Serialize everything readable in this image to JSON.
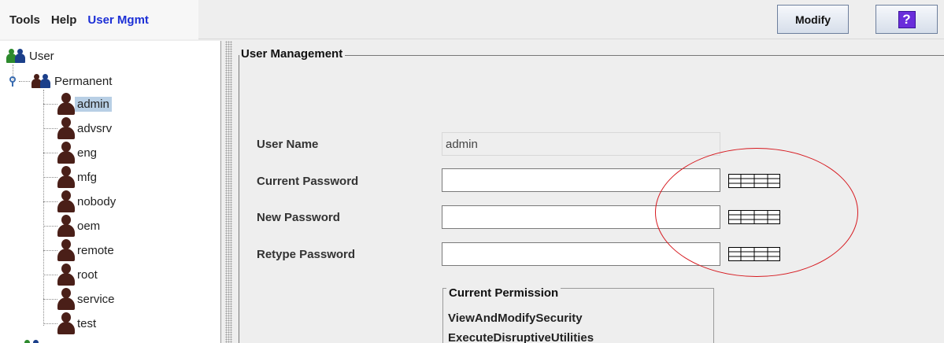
{
  "menu": {
    "tools": "Tools",
    "help": "Help",
    "user_mgmt": "User Mgmt"
  },
  "toolbar": {
    "modify_label": "Modify",
    "help_label": "?"
  },
  "tree": {
    "root": "User",
    "permanent": "Permanent",
    "users": [
      "admin",
      "advsrv",
      "eng",
      "mfg",
      "nobody",
      "oem",
      "remote",
      "root",
      "service",
      "test"
    ],
    "selected": "admin"
  },
  "form": {
    "section_title": "User Management",
    "user_name_label": "User Name",
    "user_name_value": "admin",
    "current_password_label": "Current Password",
    "new_password_label": "New Password",
    "retype_password_label": "Retype Password",
    "permission_title": "Current Permission",
    "permissions": [
      "ViewAndModifySecurity",
      "ExecuteDisruptiveUtilities"
    ]
  },
  "colors": {
    "accent": "#1c2fd6",
    "selection": "#b8cfe5",
    "annotation": "#d6191f",
    "help_icon": "#6a2ddb"
  },
  "icons": [
    "group-icon",
    "user-icon",
    "key-icon",
    "keyboard-icon",
    "help-icon"
  ]
}
